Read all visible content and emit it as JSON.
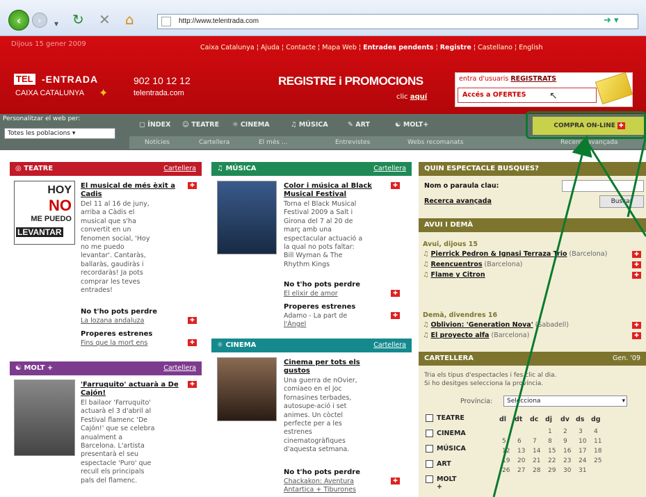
{
  "browser": {
    "url": "http://www.telentrada.com"
  },
  "site": {
    "date": "Dijous 15 gener 2009",
    "top_links": [
      "Caixa Catalunya",
      "Ajuda",
      "Contacte",
      "Mapa Web"
    ],
    "top_links_bold": [
      "Entrades pendents",
      "Registre"
    ],
    "top_lang": [
      "Castellano",
      "English"
    ],
    "logo_tel": "TEL",
    "logo_entrada": "-ENTRADA",
    "logo_caixa": "CAIXA CATALUNYA",
    "phone": "902 10 12 12",
    "phone_site": "telentrada.com",
    "register_title": "REGISTRE i PROMOCIONS",
    "register_click_prefix": "clic ",
    "register_click_link": "aquí",
    "promo_line1_prefix": "entra d'usuaris ",
    "promo_line1_bold": "REGISTRATS",
    "promo_line2": "Accés a OFERTES",
    "personalize_label": "Personalitzar el web per:",
    "personalize_value": "Totes les poblacions"
  },
  "nav": {
    "main": [
      "ÍNDEX",
      "TEATRE",
      "CINEMA",
      "MÚSICA",
      "ART",
      "MOLT+"
    ],
    "sub": [
      "Notícies",
      "Cartellera",
      "El més ...",
      "Entrevistes",
      "Webs recomanats",
      "Recerca avançada"
    ],
    "compra": "COMPRA ON-LINE"
  },
  "teatre": {
    "head": "TEATRE",
    "head_link": "Cartellera",
    "thumb_text": [
      "HOY",
      "NO",
      "ME PUEDO",
      "LEVANTAR"
    ],
    "title": "El musical de més èxit a Cadis",
    "body": [
      "Del 11 al 16 de juny,",
      "arriba a Càdis el",
      "musical que s'ha",
      "convertit en un",
      "fenomen social, 'Hoy",
      "no me puedo",
      "levantar'. Cantaràs,",
      "ballaràs, gaudiràs i",
      "recordaràs! Ja pots",
      "comprar les teves",
      "entrades!"
    ],
    "np_title": "No t'ho pots perdre",
    "np_link": "La lozana andaluza",
    "pe_title": "Properes estrenes",
    "pe_link": "Fins que la mort ens"
  },
  "musica": {
    "head": "MÚSICA",
    "head_link": "Cartellera",
    "title": "Color i música al Black Musical Festival",
    "body": [
      "Torna el Black Musical",
      "Festival 2009 a Salt i",
      "Girona del 7 al 20 de",
      "març amb una",
      "espectacular actuació a",
      "la qual no pots faltar:",
      "Bill Wyman & The",
      "Rhythm Kings"
    ],
    "np_title": "No t'ho pots perdre",
    "np_link": "El elixir de amor",
    "pe_title": "Properes estrenes",
    "pe_text": "Adamo - La part de",
    "pe_link": "l'Àngel"
  },
  "molt": {
    "head": "MOLT +",
    "head_link": "Cartellera",
    "title": "'Farruquito' actuarà a De Cajón!",
    "body": [
      "El bailaor 'Farruquito'",
      "actuarà el 3 d'abril al",
      "Festival flamenc 'De",
      "Cajón!' que se celebra",
      "anualment a",
      "Barcelona. L'artista",
      "presentarà el seu",
      "espectacle 'Puro' que",
      "recull els principals",
      "pals del flamenc."
    ]
  },
  "cinema": {
    "head": "CINEMA",
    "head_link": "Cartellera",
    "title": "Cinema per tots els gustos",
    "body": [
      "Una guerra de nOvier,",
      "comiaeo en el joc",
      "fornasines terbades,",
      "autosupe-ació i set",
      "animes. Un còctel",
      "perfecte per a les",
      "estrenes",
      "cinematogràfiques",
      "d'aquesta setmana."
    ],
    "np_title": "No t'ho pots perdre",
    "np_link": "Chackakon: Aventura",
    "np_link2": "Antartica + Tiburones"
  },
  "right": {
    "search_head": "QUIN ESPECTACLE BUSQUES?",
    "search_label": "Nom o paraula clau:",
    "search_adv": "Recerca avançada",
    "search_btn": "Buscar",
    "today_head": "AVUI I DEMÀ",
    "today_label": "Avui, dijous 15",
    "today_items": [
      {
        "title": "Pierrick Pedron & Ignasi Terraza Trio",
        "place": "(Barcelona)"
      },
      {
        "title": "Reencuentros",
        "place": "(Barcelona)"
      },
      {
        "title": "Flame y Citron",
        "place": ""
      }
    ],
    "tomorrow_label": "Demà, divendres 16",
    "tomorrow_items": [
      {
        "title": "Oblivion: 'Generation Nova'",
        "place": "(Sabadell)"
      },
      {
        "title": "El proyecto alfa",
        "place": "(Barcelona)"
      }
    ],
    "cart_head": "CARTELLERA",
    "cart_month": "Gen. '09",
    "cart_text1": "Tria els tipus d'espectacles i fes clic al dia.",
    "cart_text2": "Si ho desitges selecciona la província.",
    "prov_label": "Província:",
    "prov_value": "Selecciona",
    "cats": [
      "TEATRE",
      "CINEMA",
      "MÚSICA",
      "ART",
      "MOLT +"
    ],
    "days": [
      "dl",
      "dt",
      "dc",
      "dj",
      "dv",
      "ds",
      "dg"
    ],
    "cal": [
      [
        "",
        "",
        "",
        "1",
        "2",
        "3",
        "4"
      ],
      [
        "5",
        "6",
        "7",
        "8",
        "9",
        "10",
        "11"
      ],
      [
        "12",
        "13",
        "14",
        "15",
        "16",
        "17",
        "18"
      ],
      [
        "19",
        "20",
        "21",
        "22",
        "23",
        "24",
        "25"
      ],
      [
        "26",
        "27",
        "28",
        "29",
        "30",
        "31",
        ""
      ]
    ]
  },
  "colors": {
    "overlay_arrow": "#0a7a2e",
    "brand_red": "#c4080c"
  }
}
